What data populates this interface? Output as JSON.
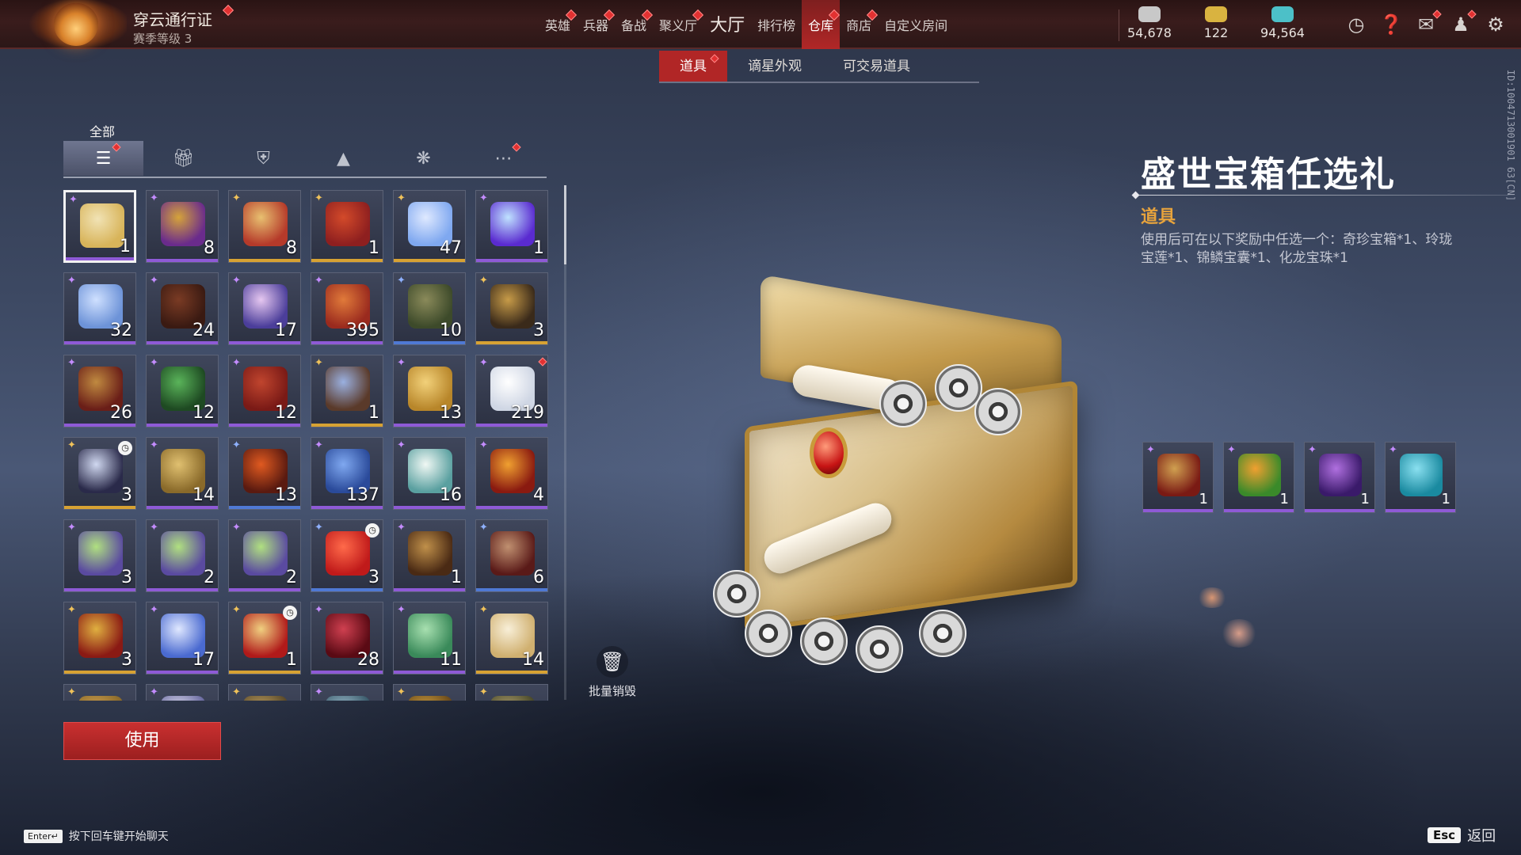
{
  "colors": {
    "accent_red": "#b12626",
    "rarity_purple": "#8e5ad6",
    "rarity_gold": "#d7a233",
    "rarity_blue": "#4f79d4",
    "detail_type": "#e7a33c"
  },
  "header": {
    "pass_title": "穿云通行证",
    "pass_level": "赛季等级 3",
    "nav": [
      {
        "label": "英雄",
        "dot": true,
        "icon": null
      },
      {
        "label": "兵器",
        "dot": true
      },
      {
        "label": "备战",
        "dot": true
      },
      {
        "label": "聚义厅",
        "dot": true
      },
      {
        "label": "大厅",
        "dot": false
      },
      {
        "label": "排行榜",
        "dot": false
      },
      {
        "label": "仓库",
        "dot": true,
        "active": true
      },
      {
        "label": "商店",
        "dot": true
      },
      {
        "label": "自定义房间",
        "dot": false
      }
    ],
    "currencies": [
      {
        "icon": "gold-coin-icon",
        "value": "54,678"
      },
      {
        "icon": "ticket-icon",
        "value": "122"
      },
      {
        "icon": "jade-feather-icon",
        "value": "94,564"
      }
    ],
    "system_icons": [
      "clock-icon",
      "help-icon",
      "mail-icon",
      "friends-icon",
      "settings-icon"
    ]
  },
  "subtabs": [
    {
      "label": "道具",
      "active": true,
      "dot": true
    },
    {
      "label": "谪星外观",
      "active": false
    },
    {
      "label": "可交易道具",
      "active": false
    }
  ],
  "categories": {
    "all_label": "全部",
    "tabs": [
      {
        "icon": "layers-icon",
        "active": true,
        "dot": true
      },
      {
        "icon": "gift-icon"
      },
      {
        "icon": "badge-icon"
      },
      {
        "icon": "flame-icon"
      },
      {
        "icon": "swirl-icon"
      },
      {
        "icon": "more-icon",
        "dot": true
      }
    ]
  },
  "inventory": [
    {
      "rarity": "purple",
      "qty": "1",
      "art": "treasure-chest-icon",
      "selected": true,
      "c1": "#d8b45a",
      "c2": "#f1e3b5"
    },
    {
      "rarity": "purple",
      "qty": "8",
      "art": "armor-icon",
      "c1": "#6a2b8c",
      "c2": "#d5a33a"
    },
    {
      "rarity": "gold",
      "qty": "8",
      "art": "bag-icon",
      "c1": "#b53a2a",
      "c2": "#e8c070"
    },
    {
      "rarity": "gold",
      "qty": "1",
      "art": "red-box-icon",
      "c1": "#8e1f1f",
      "c2": "#d34a2a"
    },
    {
      "rarity": "gold",
      "qty": "47",
      "art": "crystal-icon",
      "c1": "#7fa8f0",
      "c2": "#dfe9ff"
    },
    {
      "rarity": "purple",
      "qty": "1",
      "art": "orb-icon",
      "c1": "#5a2bd0",
      "c2": "#bfe2ff"
    },
    {
      "rarity": "purple",
      "qty": "32",
      "art": "ice-crystal-icon",
      "c1": "#6d93d8",
      "c2": "#cfe0ff"
    },
    {
      "rarity": "purple",
      "qty": "24",
      "art": "drum-icon",
      "c1": "#3a1a12",
      "c2": "#7a3b24"
    },
    {
      "rarity": "purple",
      "qty": "17",
      "art": "feather-icon",
      "c1": "#4b3e9a",
      "c2": "#e6c7f0"
    },
    {
      "rarity": "purple",
      "qty": "395",
      "art": "hammer-icon",
      "c1": "#9a2a1e",
      "c2": "#e07a3a"
    },
    {
      "rarity": "blue",
      "qty": "10",
      "art": "chest-icon",
      "c1": "#3d4a2a",
      "c2": "#8a8a5a"
    },
    {
      "rarity": "gold",
      "qty": "3",
      "art": "chest-icon",
      "c1": "#3a2a1a",
      "c2": "#c79b48"
    },
    {
      "rarity": "purple",
      "qty": "26",
      "art": "chest-icon",
      "c1": "#6a1e18",
      "c2": "#c08a40"
    },
    {
      "rarity": "purple",
      "qty": "12",
      "art": "chest-icon",
      "c1": "#1e4a22",
      "c2": "#5ab45a"
    },
    {
      "rarity": "purple",
      "qty": "12",
      "art": "chest-icon",
      "c1": "#7a1a16",
      "c2": "#c0452e"
    },
    {
      "rarity": "gold",
      "qty": "1",
      "art": "gift-set-icon",
      "c1": "#5a3a2a",
      "c2": "#9ab0e0"
    },
    {
      "rarity": "purple",
      "qty": "13",
      "art": "gold-coin-icon",
      "c1": "#b8862a",
      "c2": "#f2d17a"
    },
    {
      "rarity": "purple",
      "qty": "219",
      "art": "pearl-icon",
      "c1": "#cfd6e4",
      "c2": "#ffffff",
      "dot": true
    },
    {
      "rarity": "gold",
      "qty": "3",
      "art": "pendant-icon",
      "c1": "#2a2a4a",
      "c2": "#d0d8f0",
      "timer": true
    },
    {
      "rarity": "purple",
      "qty": "14",
      "art": "gate-icon",
      "c1": "#8a6a2a",
      "c2": "#e0c070"
    },
    {
      "rarity": "blue",
      "qty": "13",
      "art": "mask-icon",
      "c1": "#5a1a10",
      "c2": "#e05a20"
    },
    {
      "rarity": "purple",
      "qty": "137",
      "art": "gate-icon",
      "c1": "#2a4a9a",
      "c2": "#7fa8f0"
    },
    {
      "rarity": "purple",
      "qty": "16",
      "art": "lotus-icon",
      "c1": "#5aa0a0",
      "c2": "#f0f8f4"
    },
    {
      "rarity": "purple",
      "qty": "4",
      "art": "flame-icon",
      "c1": "#8a1a10",
      "c2": "#f0a030"
    },
    {
      "rarity": "purple",
      "qty": "3",
      "art": "gift-box-icon",
      "c1": "#5a4aa0",
      "c2": "#b0e080"
    },
    {
      "rarity": "purple",
      "qty": "2",
      "art": "gift-box-icon",
      "c1": "#5a4aa0",
      "c2": "#b0e080"
    },
    {
      "rarity": "purple",
      "qty": "2",
      "art": "gift-box-icon",
      "c1": "#5a4aa0",
      "c2": "#b0e080"
    },
    {
      "rarity": "blue",
      "qty": "3",
      "art": "flower-icon",
      "c1": "#c01a1a",
      "c2": "#ff6a4a",
      "timer": true
    },
    {
      "rarity": "purple",
      "qty": "1",
      "art": "chest-icon",
      "c1": "#4a2a14",
      "c2": "#c0904a"
    },
    {
      "rarity": "blue",
      "qty": "6",
      "art": "chest-icon",
      "c1": "#5a1a18",
      "c2": "#c09070"
    },
    {
      "rarity": "gold",
      "qty": "3",
      "art": "chest-icon",
      "c1": "#8a1a14",
      "c2": "#e0b040"
    },
    {
      "rarity": "purple",
      "qty": "17",
      "art": "wand-icon",
      "c1": "#4a6ad0",
      "c2": "#e0e8ff"
    },
    {
      "rarity": "gold",
      "qty": "1",
      "art": "envelope-icon",
      "c1": "#b01a1a",
      "c2": "#f0d080",
      "timer": true
    },
    {
      "rarity": "purple",
      "qty": "28",
      "art": "book-icon",
      "c1": "#5a0a14",
      "c2": "#d04050"
    },
    {
      "rarity": "purple",
      "qty": "11",
      "art": "jade-icon",
      "c1": "#3a8a5a",
      "c2": "#a8e0b0"
    },
    {
      "rarity": "gold",
      "qty": "14",
      "art": "scroll-icon",
      "c1": "#d0b070",
      "c2": "#f8efd8"
    },
    {
      "rarity": "gold",
      "qty": "",
      "art": "partial-icon",
      "c1": "#8a6a2a",
      "c2": "#d0a050"
    },
    {
      "rarity": "purple",
      "qty": "",
      "art": "partial-icon",
      "c1": "#6a6aa0",
      "c2": "#e0e0f0"
    },
    {
      "rarity": "gold",
      "qty": "",
      "art": "partial-icon",
      "c1": "#5a4a2a",
      "c2": "#c0a060"
    },
    {
      "rarity": "purple",
      "qty": "",
      "art": "partial-icon",
      "c1": "#3a5a6a",
      "c2": "#a0c0d0"
    },
    {
      "rarity": "gold",
      "qty": "",
      "art": "partial-icon",
      "c1": "#6a4a1a",
      "c2": "#d0a040"
    },
    {
      "rarity": "gold",
      "qty": "",
      "art": "partial-icon",
      "c1": "#4a4a2a",
      "c2": "#b0a070"
    }
  ],
  "bulk_destroy_label": "批量销毁",
  "use_button_label": "使用",
  "detail": {
    "title": "盛世宝箱任选礼",
    "type": "道具",
    "description": "使用后可在以下奖励中任选一个：奇珍宝箱*1、玲珑宝莲*1、锦鳞宝囊*1、化龙宝珠*1",
    "rewards": [
      {
        "qty": "1",
        "art": "red-chest-icon",
        "c1": "#7a1a14",
        "c2": "#d0a050"
      },
      {
        "qty": "1",
        "art": "lotus-lantern-icon",
        "c1": "#3a8a2a",
        "c2": "#f0a030"
      },
      {
        "qty": "1",
        "art": "pouch-icon",
        "c1": "#3a1a6a",
        "c2": "#b070e0"
      },
      {
        "qty": "1",
        "art": "dragon-pearl-icon",
        "c1": "#1a8aa0",
        "c2": "#8ae0f0"
      }
    ]
  },
  "side_id": "ID:1004713001901 63[CN]",
  "footer": {
    "enter_key": "Enter↵",
    "enter_hint": "按下回车键开始聊天",
    "esc_key": "Esc",
    "esc_label": "返回"
  }
}
